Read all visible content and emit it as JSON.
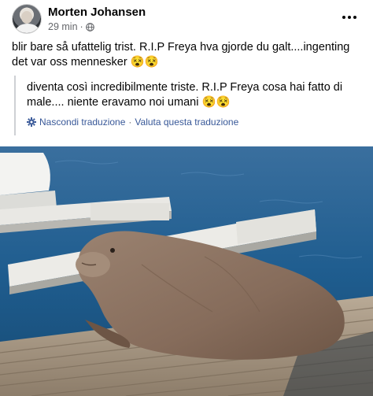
{
  "post": {
    "author": "Morten Johansen",
    "timestamp": "29 min",
    "dot": "·",
    "text": "blir bare så ufattelig trist. R.I.P Freya hva gjorde du galt....ingenting det var oss mennesker 😵😵",
    "translation_text": "diventa così incredibilmente triste. R.I.P Freya cosa hai fatto di male.... niente eravamo noi umani 😵😵",
    "hide_translation": "Nascondi traduzione",
    "link_separator": "·",
    "rate_translation": "Valuta questa traduzione"
  },
  "icons": {
    "more": "more-options-icon",
    "globe": "globe-icon",
    "gear": "gear-icon"
  },
  "colors": {
    "link": "#385898",
    "secondary_text": "#65676b",
    "water": "#1f5d8f",
    "walrus": "#8a7261"
  }
}
